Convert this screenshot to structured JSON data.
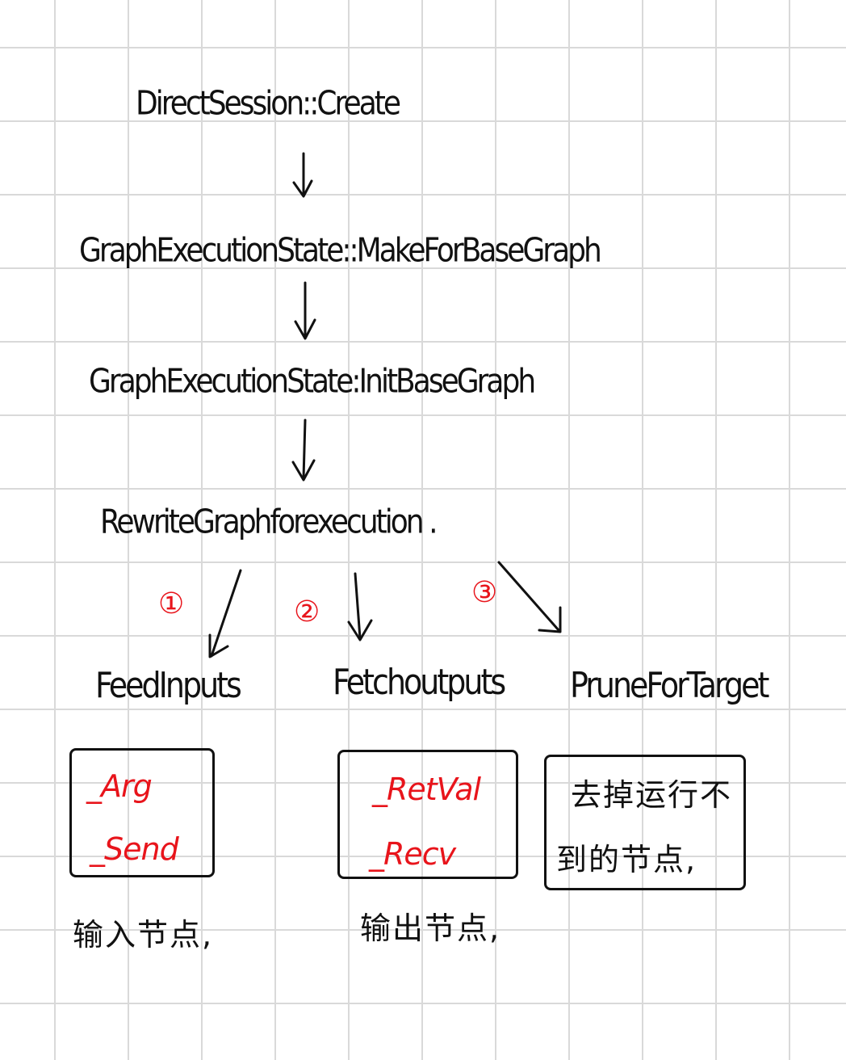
{
  "flow": {
    "steps": [
      "DirectSession::Create",
      "GraphExecutionState::MakeForBaseGraph",
      "GraphExecutionState:InitBaseGraph",
      "RewriteGraphforexecution ."
    ]
  },
  "branches": [
    {
      "badge": "①",
      "title": "FeedInputs",
      "items": [
        "_Arg",
        "_Send"
      ],
      "caption": "输入节点,"
    },
    {
      "badge": "②",
      "title": "Fetchoutputs",
      "items": [
        "_RetVal",
        "_Recv"
      ],
      "caption": "输出节点,"
    },
    {
      "badge": "③",
      "title": "PruneForTarget",
      "note_lines": [
        "去掉运行不",
        "到的节点,"
      ]
    }
  ],
  "colors": {
    "ink": "#111111",
    "highlight": "#e8141b",
    "grid": "#d9d9d9"
  }
}
